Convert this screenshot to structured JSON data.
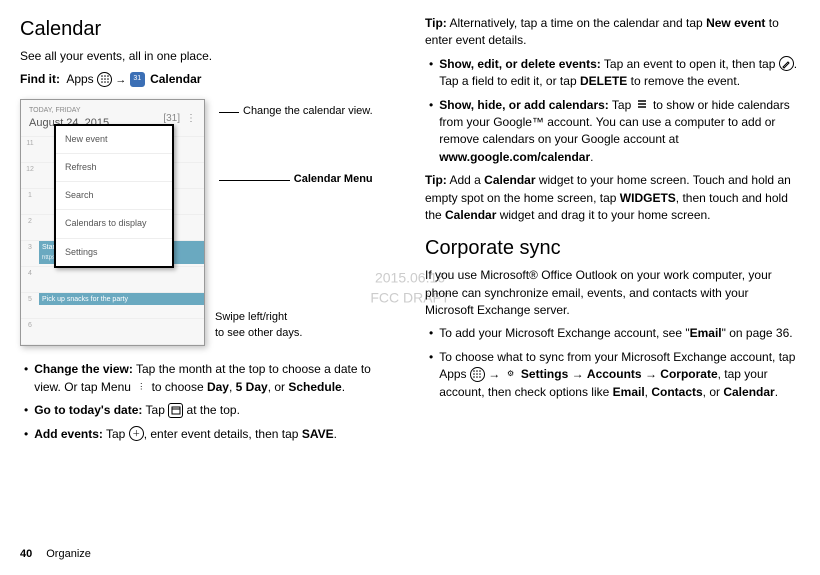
{
  "left": {
    "title": "Calendar",
    "subtitle": "See all your events, all in one place.",
    "find_label": "Find it:",
    "find_apps_word": "Apps",
    "find_arrow": "→",
    "find_cal_word": "Calendar",
    "phone": {
      "today_label": "TODAY, FRIDAY",
      "date": "August 24, 2015",
      "menu": [
        "New event",
        "Refresh",
        "Search",
        "Calendars to display",
        "Settings"
      ],
      "hours": [
        "11",
        "12",
        "1",
        "2",
        "3",
        "4",
        "5",
        "6"
      ],
      "event1_title": "Start hangout with Alexis",
      "event1_url": "https://plus.google.com/hangouts",
      "event2_title": "Pick up snacks for the party"
    },
    "annot_top": "Change the calendar view.",
    "annot_menu": "Calendar Menu",
    "annot_swipe1": "Swipe left/right",
    "annot_swipe2": "to see other days.",
    "b1_lead": "Change the view:",
    "b1_rest_a": " Tap the month at the top to choose a date to view. Or tap Menu ",
    "b1_rest_b": " to choose ",
    "b1_day": "Day",
    "b1_comma": ", ",
    "b1_5day": "5 Day",
    "b1_or": ", or ",
    "b1_sched": "Schedule",
    "b1_period": ".",
    "b2_lead": "Go to today's date:",
    "b2_rest_a": " Tap ",
    "b2_rest_b": " at the top.",
    "b3_lead": "Add events:",
    "b3_rest_a": " Tap ",
    "b3_rest_b": ", enter event details, then tap ",
    "b3_save": "SAVE",
    "b3_period": "."
  },
  "right": {
    "tip1_lead": "Tip:",
    "tip1_rest_a": " Alternatively, tap a time on the calendar and tap ",
    "tip1_new_event": "New event",
    "tip1_rest_b": " to enter event details.",
    "b1_lead": "Show, edit, or delete events:",
    "b1_rest_a": " Tap an event to open it, then tap ",
    "b1_rest_b": ". Tap a field to edit it, or tap ",
    "b1_delete": "DELETE",
    "b1_rest_c": " to remove the event.",
    "b2_lead": "Show, hide, or add calendars:",
    "b2_rest_a": " Tap ",
    "b2_rest_b": " to show or hide calendars from your Google™ account. You can use a computer to add or remove calendars on your Google account at ",
    "b2_url": "www.google.com/calendar",
    "b2_period": ".",
    "tip2_lead": "Tip:",
    "tip2_rest_a": " Add a ",
    "tip2_cal": "Calendar",
    "tip2_rest_b": " widget to your home screen. Touch and hold an empty spot on the home screen, tap ",
    "tip2_widgets": "WIDGETS",
    "tip2_rest_c": ", then touch and hold the ",
    "tip2_cal2": "Calendar",
    "tip2_rest_d": "  widget and drag it to your home screen.",
    "h2": "Corporate sync",
    "cs_intro": "If you use Microsoft® Office Outlook on your work computer, your phone can synchronize email, events, and contacts with your Microsoft Exchange server.",
    "cs_b1_a": "To add your Microsoft Exchange account, see \"",
    "cs_b1_email": "Email",
    "cs_b1_b": "\" on page 36.",
    "cs_b2_a": "To choose what to sync from your Microsoft Exchange account, tap Apps ",
    "cs_b2_b": " → ",
    "cs_b2_settings": "Settings",
    "cs_b2_c": " → ",
    "cs_b2_accounts": "Accounts",
    "cs_b2_d": " → ",
    "cs_b2_corporate": "Corporate",
    "cs_b2_e": ", tap your account, then check options like ",
    "cs_b2_emailw": "Email",
    "cs_b2_f": ", ",
    "cs_b2_contacts": "Contacts",
    "cs_b2_g": ", or ",
    "cs_b2_calendar": "Calendar",
    "cs_b2_h": "."
  },
  "footer": {
    "page": "40",
    "section": "Organize"
  },
  "watermark": {
    "l1": "2015.06.16",
    "l2": "FCC DRAFT"
  }
}
